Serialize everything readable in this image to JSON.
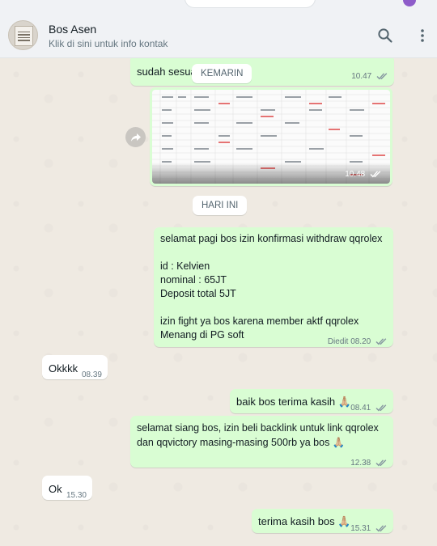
{
  "header": {
    "contact_name": "Bos Asen",
    "contact_subtitle": "Klik di sini untuk info kontak",
    "avatar_icon": "profile-photo",
    "search_icon": "search-icon",
    "menu_icon": "more-vertical-icon"
  },
  "colors": {
    "outgoing_bubble": "#d9fdd3",
    "incoming_bubble": "#ffffff",
    "chat_background": "#efeae2",
    "read_ticks": "#53bdeb",
    "sent_ticks": "#8696a0"
  },
  "date_separators": {
    "yesterday": "KEMARIN",
    "today": "HARI INI"
  },
  "messages": [
    {
      "id": "m1",
      "direction": "out",
      "text": "sudah sesua",
      "time": "10.47",
      "status": "sent"
    },
    {
      "id": "m2",
      "direction": "out",
      "type": "image",
      "time": "10.48",
      "status": "sent",
      "content": "spreadsheet-screenshot"
    },
    {
      "id": "m3",
      "direction": "out",
      "lines": [
        "selamat pagi bos izin konfirmasi withdraw qqrolex",
        "",
        "id : Kelvien",
        "nominal : 65JT",
        "Deposit total 5JT",
        "",
        "izin fight ya bos karena member aktf qqrolex",
        "Menang di PG soft"
      ],
      "edited_label": "Diedit",
      "time": "08.20",
      "status": "sent"
    },
    {
      "id": "m4",
      "direction": "in",
      "text": "Okkkk",
      "time": "08.39"
    },
    {
      "id": "m5",
      "direction": "out",
      "text": "baik bos terima kasih 🙏🏼",
      "time": "08.41",
      "status": "sent"
    },
    {
      "id": "m6",
      "direction": "out",
      "lines": [
        "selamat siang bos, izin beli backlink untuk link qqrolex",
        "dan qqvictory masing-masing 500rb ya bos 🙏🏼"
      ],
      "time": "12.38",
      "status": "sent"
    },
    {
      "id": "m7",
      "direction": "in",
      "text": "Ok",
      "time": "15.30"
    },
    {
      "id": "m8",
      "direction": "out",
      "text": "terima kasih bos 🙏🏼",
      "time": "15.31",
      "status": "sent"
    }
  ],
  "forward_icon": "forward-icon"
}
